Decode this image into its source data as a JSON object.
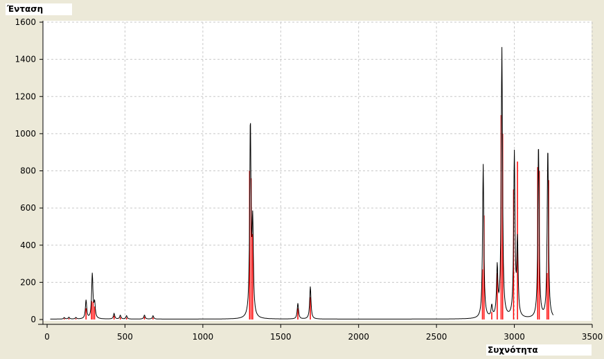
{
  "chart_data": {
    "type": "line",
    "xlabel": "Συχνότητα",
    "ylabel": "Ένταση",
    "xlim": [
      0,
      3500
    ],
    "ylim": [
      0,
      1600
    ],
    "x_ticks": [
      0,
      500,
      1000,
      1500,
      2000,
      2500,
      3000,
      3500
    ],
    "y_ticks": [
      0,
      200,
      400,
      600,
      800,
      1000,
      1200,
      1400,
      1600
    ],
    "grid": true,
    "colors": {
      "spectrum": "#000000",
      "sticks": "#ff0000",
      "plot_bg": "#ffffff",
      "grid": "#c8c8c8"
    },
    "line_width": 10,
    "series": [
      {
        "kind": "spectrum",
        "peaks": [
          {
            "x": 110,
            "y": 8
          },
          {
            "x": 140,
            "y": 10
          },
          {
            "x": 185,
            "y": 8
          },
          {
            "x": 250,
            "y": 100
          },
          {
            "x": 290,
            "y": 240
          },
          {
            "x": 305,
            "y": 80
          },
          {
            "x": 430,
            "y": 30
          },
          {
            "x": 470,
            "y": 20
          },
          {
            "x": 510,
            "y": 18
          },
          {
            "x": 625,
            "y": 22
          },
          {
            "x": 680,
            "y": 18
          },
          {
            "x": 1305,
            "y": 1040
          },
          {
            "x": 1320,
            "y": 480
          },
          {
            "x": 1610,
            "y": 85
          },
          {
            "x": 1690,
            "y": 175
          },
          {
            "x": 2800,
            "y": 830
          },
          {
            "x": 2855,
            "y": 60
          },
          {
            "x": 2890,
            "y": 260
          },
          {
            "x": 2920,
            "y": 1450
          },
          {
            "x": 3000,
            "y": 880
          },
          {
            "x": 3020,
            "y": 400
          },
          {
            "x": 3155,
            "y": 940
          },
          {
            "x": 3215,
            "y": 920
          }
        ]
      },
      {
        "kind": "sticks",
        "sticks": [
          {
            "x": 110,
            "y": 5
          },
          {
            "x": 140,
            "y": 6
          },
          {
            "x": 185,
            "y": 5
          },
          {
            "x": 250,
            "y": 60
          },
          {
            "x": 285,
            "y": 100
          },
          {
            "x": 295,
            "y": 95
          },
          {
            "x": 305,
            "y": 70
          },
          {
            "x": 430,
            "y": 20
          },
          {
            "x": 470,
            "y": 12
          },
          {
            "x": 510,
            "y": 10
          },
          {
            "x": 625,
            "y": 15
          },
          {
            "x": 680,
            "y": 10
          },
          {
            "x": 1300,
            "y": 800
          },
          {
            "x": 1310,
            "y": 760
          },
          {
            "x": 1320,
            "y": 460
          },
          {
            "x": 1610,
            "y": 60
          },
          {
            "x": 1690,
            "y": 120
          },
          {
            "x": 2795,
            "y": 270
          },
          {
            "x": 2805,
            "y": 560
          },
          {
            "x": 2855,
            "y": 40
          },
          {
            "x": 2890,
            "y": 250
          },
          {
            "x": 2915,
            "y": 1100
          },
          {
            "x": 2925,
            "y": 1000
          },
          {
            "x": 2995,
            "y": 700
          },
          {
            "x": 3020,
            "y": 850
          },
          {
            "x": 3150,
            "y": 820
          },
          {
            "x": 3160,
            "y": 800
          },
          {
            "x": 3210,
            "y": 250
          },
          {
            "x": 3220,
            "y": 750
          }
        ]
      }
    ]
  }
}
